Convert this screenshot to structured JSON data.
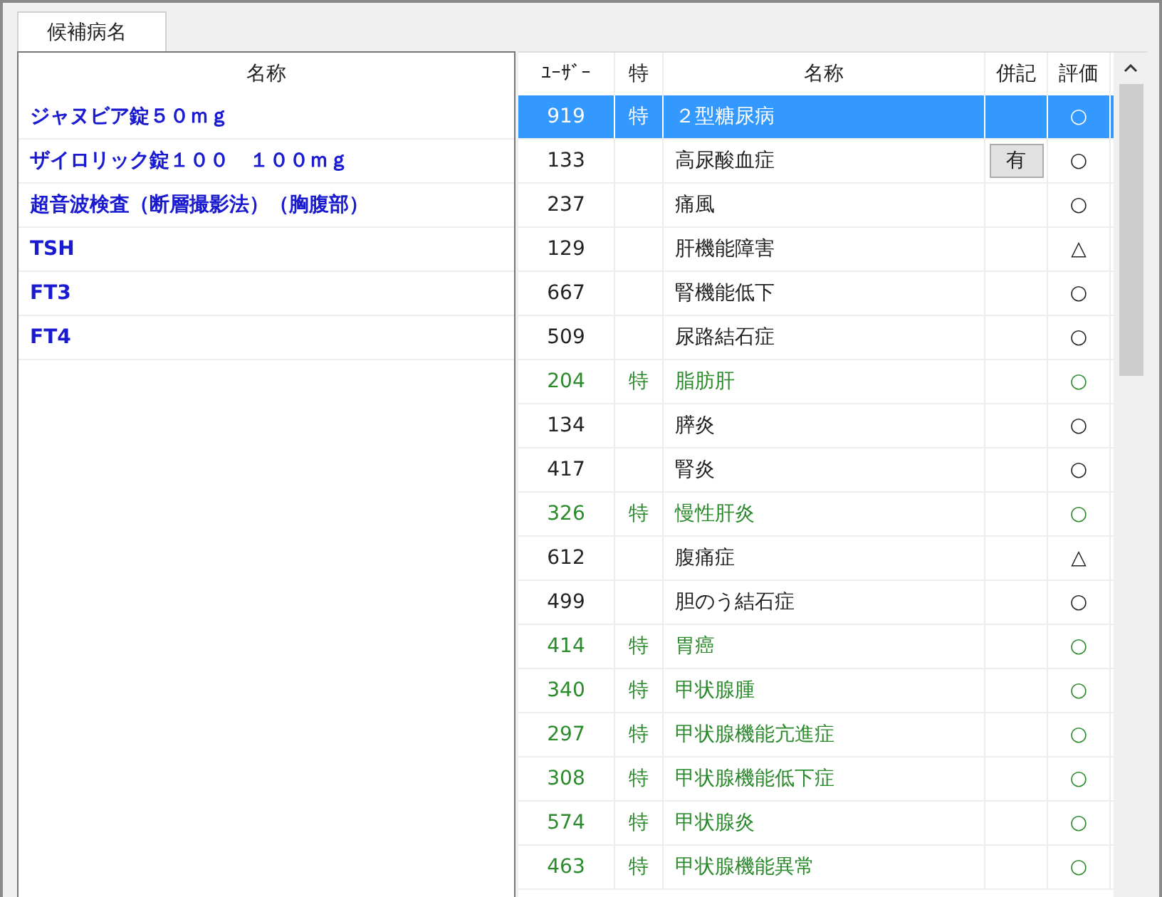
{
  "tab": {
    "label": "候補病名",
    "selected": true
  },
  "left_list": {
    "header": "名称",
    "items": [
      "ジャヌビア錠５０ｍｇ",
      "ザイロリック錠１００　１００ｍｇ",
      "超音波検査（断層撮影法）（胸腹部）",
      "TSH",
      "FT3",
      "FT4"
    ]
  },
  "grid": {
    "columns": [
      "ﾕｰｻﾞｰ",
      "特",
      "名称",
      "併記",
      "評価"
    ],
    "rows": [
      {
        "user": "919",
        "special": "特",
        "name": "２型糖尿病",
        "rating": "○",
        "selected": true,
        "kind": "special"
      },
      {
        "user": "133",
        "name": "高尿酸血症",
        "combined": "有",
        "rating": "○",
        "selected": false,
        "kind": "normal"
      },
      {
        "user": "237",
        "name": "痛風",
        "rating": "○",
        "selected": false,
        "kind": "normal"
      },
      {
        "user": "129",
        "name": "肝機能障害",
        "rating": "△",
        "selected": false,
        "kind": "normal"
      },
      {
        "user": "667",
        "name": "腎機能低下",
        "rating": "○",
        "selected": false,
        "kind": "normal"
      },
      {
        "user": "509",
        "name": "尿路結石症",
        "rating": "○",
        "selected": false,
        "kind": "normal"
      },
      {
        "user": "204",
        "special": "特",
        "name": "脂肪肝",
        "rating": "○",
        "selected": false,
        "kind": "special"
      },
      {
        "user": "134",
        "name": "膵炎",
        "rating": "○",
        "selected": false,
        "kind": "normal"
      },
      {
        "user": "417",
        "name": "腎炎",
        "rating": "○",
        "selected": false,
        "kind": "normal"
      },
      {
        "user": "326",
        "special": "特",
        "name": "慢性肝炎",
        "rating": "○",
        "selected": false,
        "kind": "special"
      },
      {
        "user": "612",
        "name": "腹痛症",
        "rating": "△",
        "selected": false,
        "kind": "normal"
      },
      {
        "user": "499",
        "name": "胆のう結石症",
        "rating": "○",
        "selected": false,
        "kind": "normal"
      },
      {
        "user": "414",
        "special": "特",
        "name": "胃癌",
        "rating": "○",
        "selected": false,
        "kind": "special"
      },
      {
        "user": "340",
        "special": "特",
        "name": "甲状腺腫",
        "rating": "○",
        "selected": false,
        "kind": "special"
      },
      {
        "user": "297",
        "special": "特",
        "name": "甲状腺機能亢進症",
        "rating": "○",
        "selected": false,
        "kind": "special"
      },
      {
        "user": "308",
        "special": "特",
        "name": "甲状腺機能低下症",
        "rating": "○",
        "selected": false,
        "kind": "special"
      },
      {
        "user": "574",
        "special": "特",
        "name": "甲状腺炎",
        "rating": "○",
        "selected": false,
        "kind": "special"
      },
      {
        "user": "463",
        "special": "特",
        "name": "甲状腺機能異常",
        "rating": "○",
        "selected": false,
        "kind": "special"
      }
    ]
  }
}
